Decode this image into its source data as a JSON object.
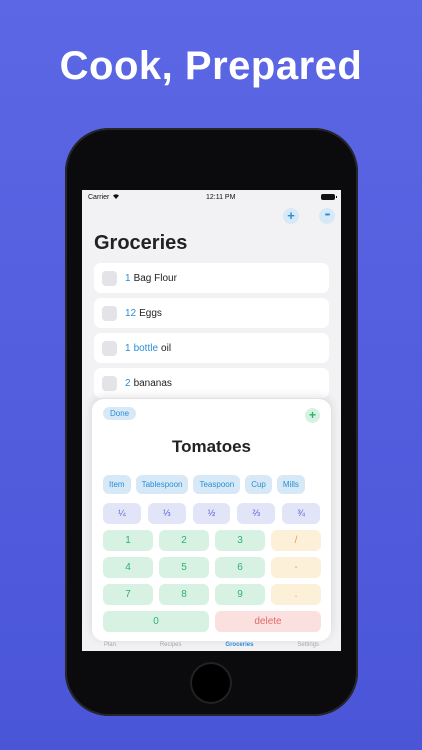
{
  "headline": "Cook, Prepared",
  "status": {
    "carrier": "Carrier",
    "time": "12:11 PM"
  },
  "toolbar": {
    "add_label": "+",
    "more_label": "•••"
  },
  "page_title": "Groceries",
  "items": [
    {
      "qty": "1",
      "unit": "",
      "name": "Bag Flour"
    },
    {
      "qty": "12",
      "unit": "",
      "name": "Eggs"
    },
    {
      "qty": "1",
      "unit": "bottle",
      "name": "oil"
    },
    {
      "qty": "2",
      "unit": "",
      "name": "bananas"
    }
  ],
  "sheet": {
    "done_label": "Done",
    "add_label": "+",
    "title": "Tomatoes",
    "units": [
      "Item",
      "Tablespoon",
      "Teaspoon",
      "Cup",
      "Mills"
    ],
    "fractions": [
      "¼",
      "⅓",
      "½",
      "⅔",
      "¾"
    ],
    "keys": [
      "1",
      "2",
      "3",
      "/",
      "4",
      "5",
      "6",
      "-",
      "7",
      "8",
      "9",
      "."
    ],
    "zero_label": "0",
    "delete_label": "delete"
  },
  "tabs": [
    "Plan",
    "Recipes",
    "Groceries",
    "Settings"
  ],
  "colors": {
    "accent": "#2a8fd8",
    "green": "#2fb26d",
    "orange": "#e5a23a",
    "red": "#e56a6a",
    "background": "#5b67e4"
  }
}
